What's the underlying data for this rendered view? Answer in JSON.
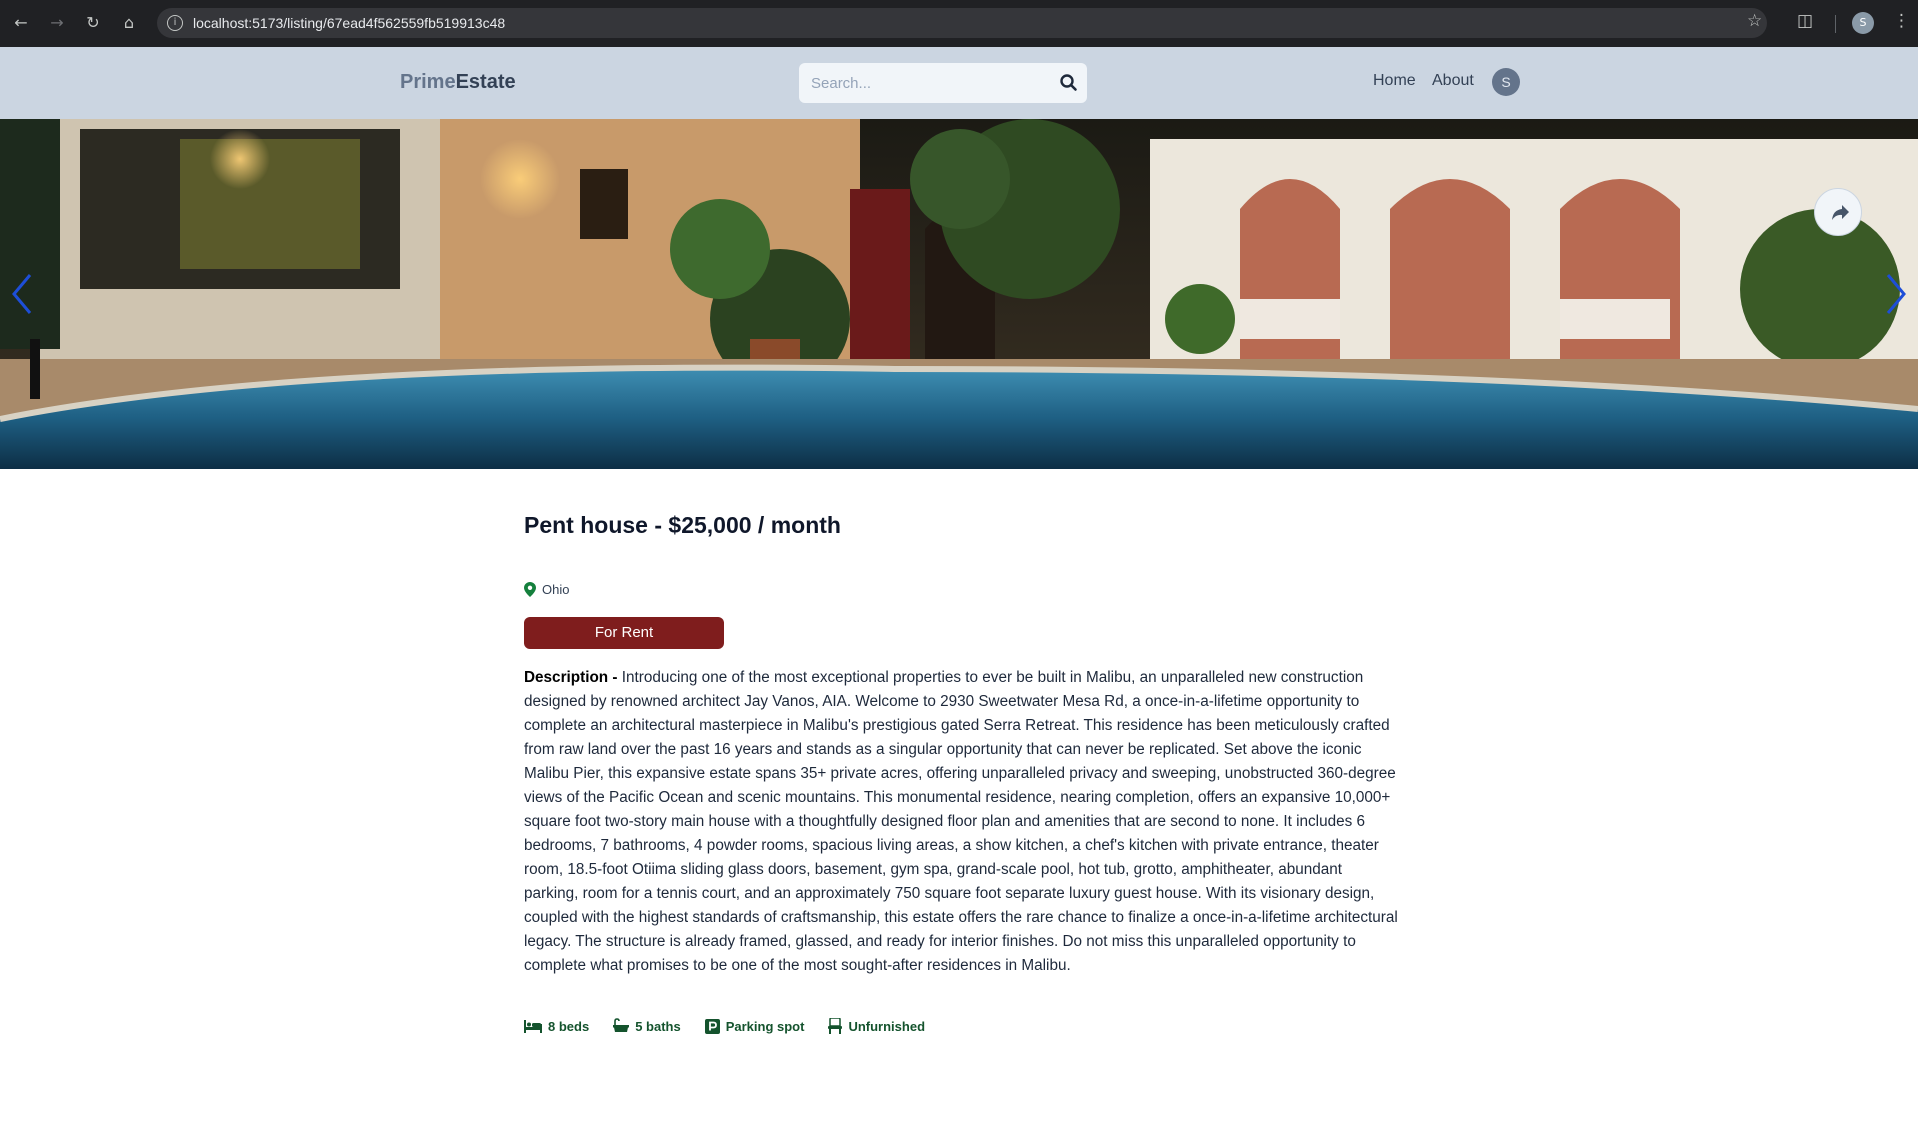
{
  "browser": {
    "url": "localhost:5173/listing/67ead4f562559fb519913c48",
    "profile_initial": "S"
  },
  "header": {
    "logo_part1": "Prime",
    "logo_part2": "Estate",
    "search_placeholder": "Search...",
    "nav": [
      "Home",
      "About"
    ],
    "avatar_initial": "S"
  },
  "listing": {
    "title": "Pent house - $25,000 / month",
    "location": "Ohio",
    "type_badge": "For Rent",
    "description_label": "Description - ",
    "description": "Introducing one of the most exceptional properties to ever be built in Malibu, an unparalleled new construction designed by renowned architect Jay Vanos, AIA. Welcome to 2930 Sweetwater Mesa Rd, a once-in-a-lifetime opportunity to complete an architectural masterpiece in Malibu's prestigious gated Serra Retreat. This residence has been meticulously crafted from raw land over the past 16 years and stands as a singular opportunity that can never be replicated. Set above the iconic Malibu Pier, this expansive estate spans 35+ private acres, offering unparalleled privacy and sweeping, unobstructed 360-degree views of the Pacific Ocean and scenic mountains. This monumental residence, nearing completion, offers an expansive 10,000+ square foot two-story main house with a thoughtfully designed floor plan and amenities that are second to none. It includes 6 bedrooms, 7 bathrooms, 4 powder rooms, spacious living areas, a show kitchen, a chef's kitchen with private entrance, theater room, 18.5-foot Otiima sliding glass doors, basement, gym spa, grand-scale pool, hot tub, grotto, amphitheater, abundant parking, room for a tennis court, and an approximately 750 square foot separate luxury guest house. With its visionary design, coupled with the highest standards of craftsmanship, this estate offers the rare chance to finalize a once-in-a-lifetime architectural legacy. The structure is already framed, glassed, and ready for interior finishes. Do not miss this unparalleled opportunity to complete what promises to be one of the most sought-after residences in Malibu.",
    "features": {
      "beds": "8 beds",
      "baths": "5 baths",
      "parking": "Parking spot",
      "furnished": "Unfurnished"
    }
  },
  "colors": {
    "header_bg": "#cbd5e1",
    "badge_bg": "#7f1d1d",
    "feature_text": "#14532d",
    "carousel_arrow": "#1d4ed8"
  }
}
